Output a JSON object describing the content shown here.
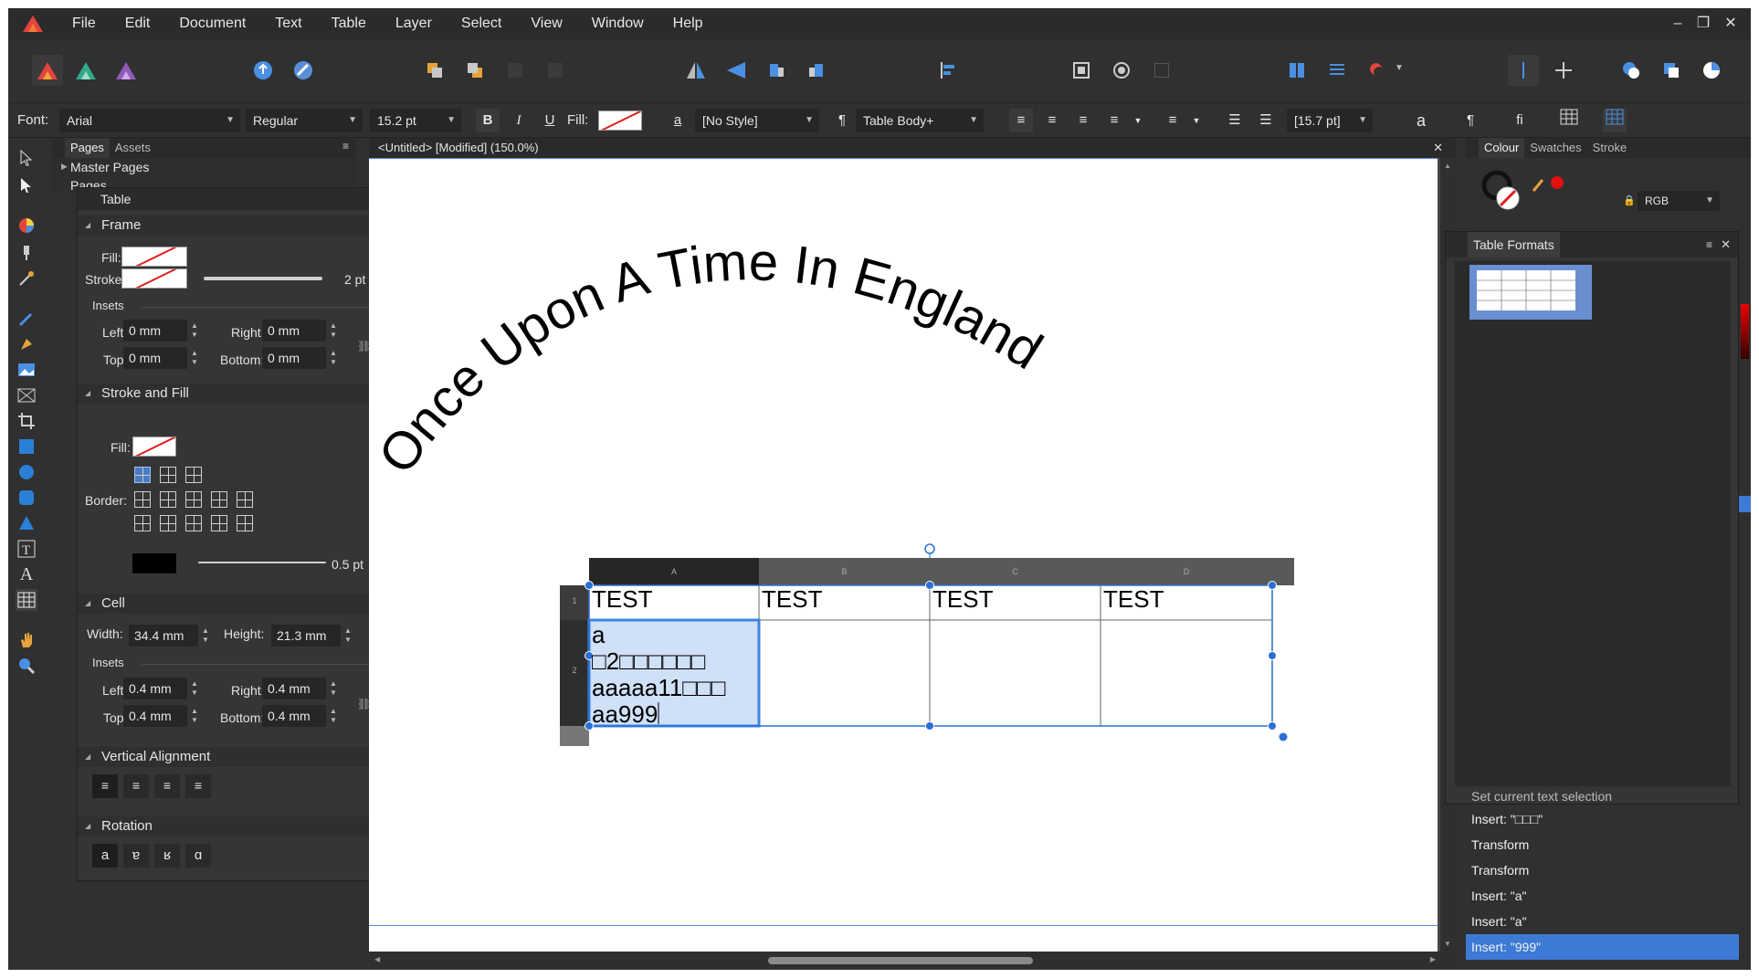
{
  "menu": [
    "File",
    "Edit",
    "Document",
    "Text",
    "Table",
    "Layer",
    "Select",
    "View",
    "Window",
    "Help"
  ],
  "window_controls": {
    "minimize": "–",
    "restore": "❐",
    "close": "✕"
  },
  "context_bar": {
    "font_label": "Font:",
    "font_family": "Arial",
    "font_style": "Regular",
    "font_size": "15.2 pt",
    "bold": "B",
    "italic": "I",
    "underline": "U",
    "fill_label": "Fill:",
    "char_style_icon": "a",
    "char_style": "[No Style]",
    "para_icon": "¶",
    "para_style": "Table Body+",
    "leading": "[15.7 pt]",
    "btn_a": "a",
    "btn_pilcrow": "¶",
    "btn_fi": "fi"
  },
  "pages_panel": {
    "tabs": [
      "Pages",
      "Assets"
    ],
    "master_pages": "Master Pages",
    "pages": "Pages"
  },
  "table_panel": {
    "title": "Table",
    "close": "×",
    "frame": {
      "heading": "Frame",
      "fill_label": "Fill:",
      "stroke_label": "Stroke:",
      "stroke_width": "2 pt",
      "insets_label": "Insets",
      "left_label": "Left:",
      "left": "0 mm",
      "right_label": "Right:",
      "right": "0 mm",
      "top_label": "Top:",
      "top": "0 mm",
      "bottom_label": "Bottom:",
      "bottom": "0 mm"
    },
    "stroke_fill": {
      "heading": "Stroke and Fill",
      "fill_label": "Fill:",
      "border_label": "Border:",
      "border_width": "0.5 pt"
    },
    "cell": {
      "heading": "Cell",
      "width_label": "Width:",
      "width": "34.4 mm",
      "height_label": "Height:",
      "height": "21.3 mm",
      "insets_label": "Insets",
      "left_label": "Left:",
      "left": "0.4 mm",
      "right_label": "Right:",
      "right": "0.4 mm",
      "top_label": "Top:",
      "top": "0.4 mm",
      "bottom_label": "Bottom:",
      "bottom": "0.4 mm"
    },
    "valign": {
      "heading": "Vertical Alignment"
    },
    "rotation": {
      "heading": "Rotation",
      "buttons": [
        "a",
        "ɐ",
        "ʁ",
        "ɑ"
      ]
    }
  },
  "document": {
    "tab_title": "<Untitled> [Modified] (150.0%)",
    "tab_close": "✕",
    "arc_text": "Once Upon A Time In England",
    "table": {
      "columns": [
        "A",
        "B",
        "C",
        "D"
      ],
      "rows": [
        "1",
        "2"
      ],
      "header_cells": [
        "TEST",
        "TEST",
        "TEST",
        "TEST"
      ],
      "selected_cell_lines": [
        "a",
        "□2□□□□□□",
        "aaaaa11□□□",
        "aa999"
      ]
    }
  },
  "right_panel": {
    "tabs": [
      "Colour",
      "Swatches",
      "Stroke"
    ],
    "color_model": "RGB",
    "table_formats_title": "Table Formats"
  },
  "history": {
    "partial_item": "Set current text selection",
    "items": [
      "Insert: \"□□□\"",
      "Transform",
      "Transform",
      "Insert: \"a\"",
      "Insert: \"a\"",
      "Insert: \"999\""
    ],
    "selected_index": 5
  },
  "colors": {
    "accent": "#4a7cc4",
    "selection": "#2a6fd6",
    "history_selected": "#3d7ad6"
  }
}
